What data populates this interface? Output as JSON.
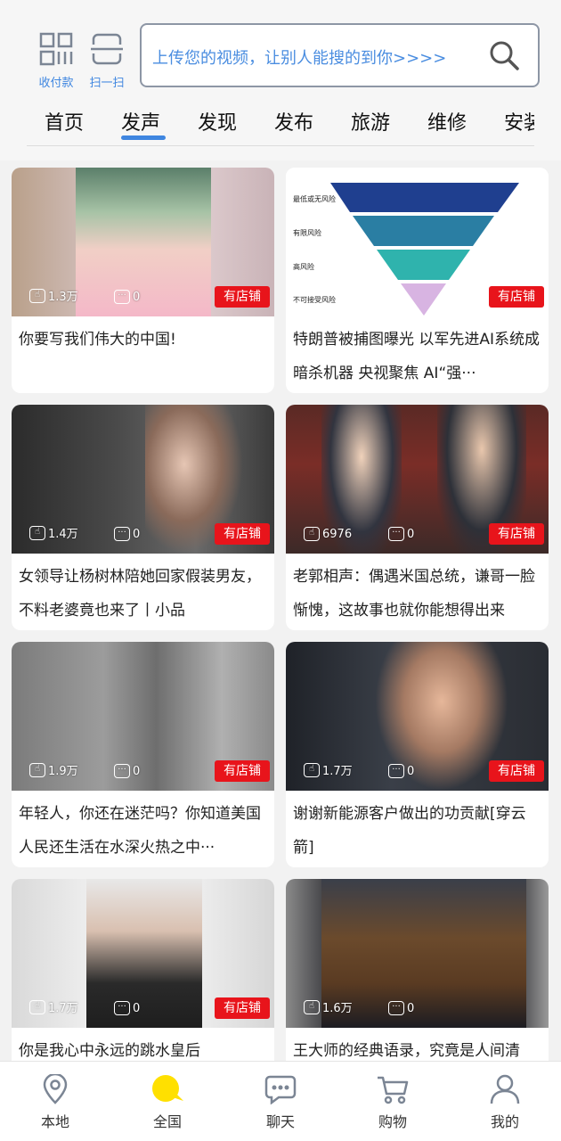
{
  "header": {
    "pay_label": "收付款",
    "scan_label": "扫一扫",
    "search_placeholder": "上传您的视频，让别人能搜的到你>>>>",
    "accent_color": "#3f86e0"
  },
  "tabs": [
    "首页",
    "发声",
    "发现",
    "发布",
    "旅游",
    "维修",
    "安装"
  ],
  "active_tab": "发声",
  "shop_label": "有店铺",
  "cards": [
    {
      "likes": "1.3万",
      "comments": "0",
      "title": "你要写我们伟大的中国!"
    },
    {
      "likes": "",
      "comments": "",
      "title": "特朗普被捕图曝光 以军先进AI系统成暗杀机器 央视聚焦 AI“强···",
      "pyramid": [
        "最低或无风险",
        "有限风险",
        "高风险",
        "不可接受风险"
      ]
    },
    {
      "likes": "1.4万",
      "comments": "0",
      "title": "女领导让杨树林陪她回家假装男友，不料老婆竟也来了丨小品"
    },
    {
      "likes": "6976",
      "comments": "0",
      "title": "老郭相声：偶遇米国总统，谦哥一脸惭愧，这故事也就你能想得出来"
    },
    {
      "likes": "1.9万",
      "comments": "0",
      "title": "年轻人，你还在迷茫吗？你知道美国人民还生活在水深火热之中···"
    },
    {
      "likes": "1.7万",
      "comments": "0",
      "title": "谢谢新能源客户做出的功贡献[穿云箭]"
    },
    {
      "likes": "1.7万",
      "comments": "0",
      "title": "你是我心中永远的跳水皇后"
    },
    {
      "likes": "1.6万",
      "comments": "0",
      "title": "王大师的经典语录，究竟是人间清"
    }
  ],
  "bottom_nav": [
    {
      "label": "本地",
      "icon": "location-pin-icon"
    },
    {
      "label": "全国",
      "icon": "globe-icon"
    },
    {
      "label": "聊天",
      "icon": "chat-bubble-icon"
    },
    {
      "label": "购物",
      "icon": "shopping-cart-icon"
    },
    {
      "label": "我的",
      "icon": "user-icon"
    }
  ],
  "colors": {
    "shop_badge": "#e8141b",
    "active_nav": "#ffe000"
  }
}
